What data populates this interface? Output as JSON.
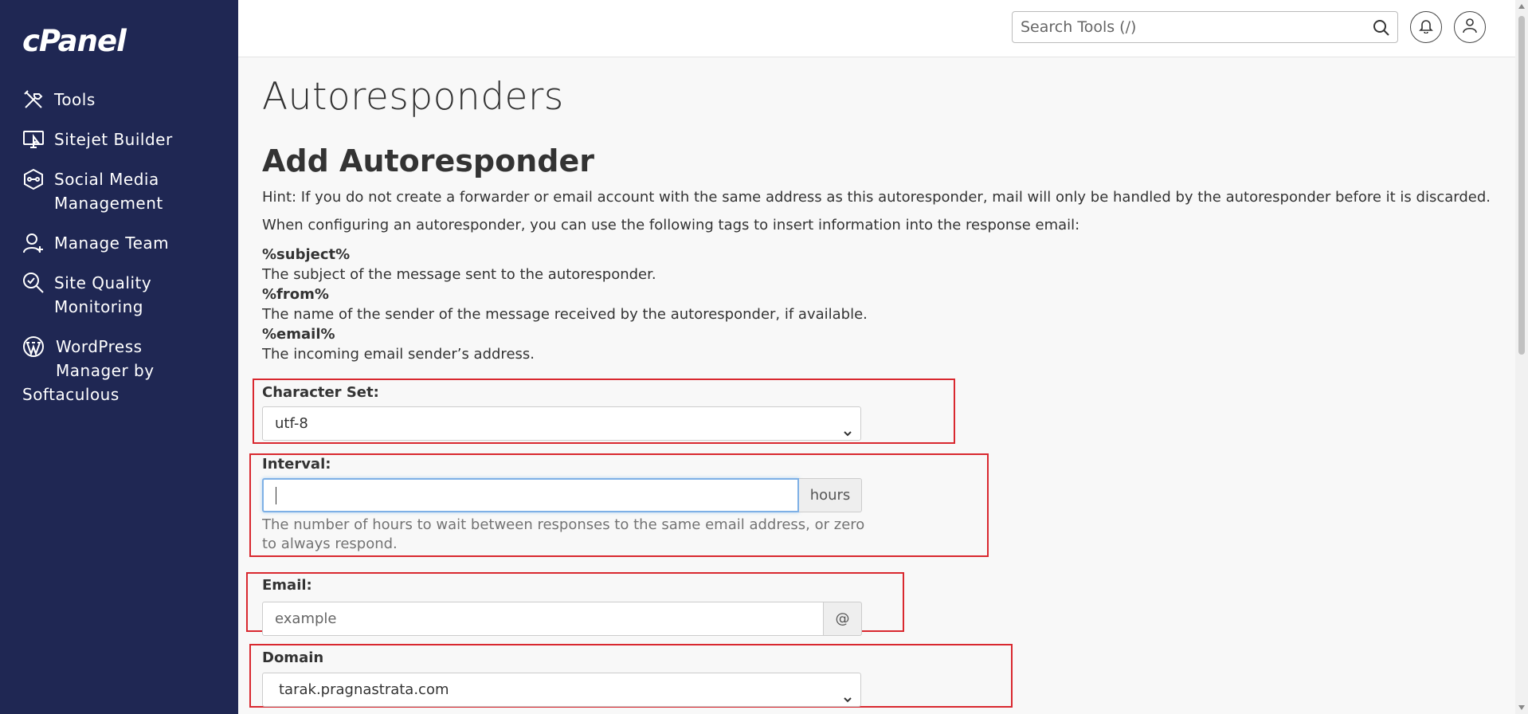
{
  "sidebar": {
    "logo": "cPanel",
    "items": [
      {
        "label": "Tools",
        "icon": "tools-icon"
      },
      {
        "label": "Sitejet Builder",
        "icon": "sitejet-icon"
      },
      {
        "label": "Social Media",
        "label2": "Management",
        "icon": "social-media-icon"
      },
      {
        "label": "Manage Team",
        "icon": "manage-team-icon"
      },
      {
        "label": "Site Quality",
        "label2": "Monitoring",
        "icon": "site-quality-icon"
      },
      {
        "label": "WordPress",
        "label2": "Manager by",
        "label3": "Softaculous",
        "icon": "wordpress-icon"
      }
    ]
  },
  "topbar": {
    "search_placeholder": "Search Tools (/)"
  },
  "page": {
    "title": "Autoresponders",
    "section_title": "Add Autoresponder",
    "hint": "Hint: If you do not create a forwarder or email account with the same address as this autoresponder, mail will only be handled by the autoresponder before it is discarded.",
    "tags_intro": "When configuring an autoresponder, you can use the following tags to insert information into the response email:",
    "tags": [
      {
        "tag": "%subject%",
        "desc": "The subject of the message sent to the autoresponder."
      },
      {
        "tag": "%from%",
        "desc": "The name of the sender of the message received by the autoresponder, if available."
      },
      {
        "tag": "%email%",
        "desc": "The incoming email sender’s address."
      }
    ]
  },
  "form": {
    "charset_label": "Character Set:",
    "charset_value": "utf-8",
    "interval_label": "Interval:",
    "interval_value": "",
    "interval_addon": "hours",
    "interval_help": "The number of hours to wait between responses to the same email address, or zero to always respond.",
    "email_label": "Email:",
    "email_placeholder": "example",
    "email_addon": "@",
    "domain_label": "Domain",
    "domain_value": "tarak.pragnastrata.com"
  },
  "colors": {
    "sidebar_bg": "#1f2753",
    "highlight_box": "#d9282f",
    "focus_border": "#7eb0e6"
  }
}
